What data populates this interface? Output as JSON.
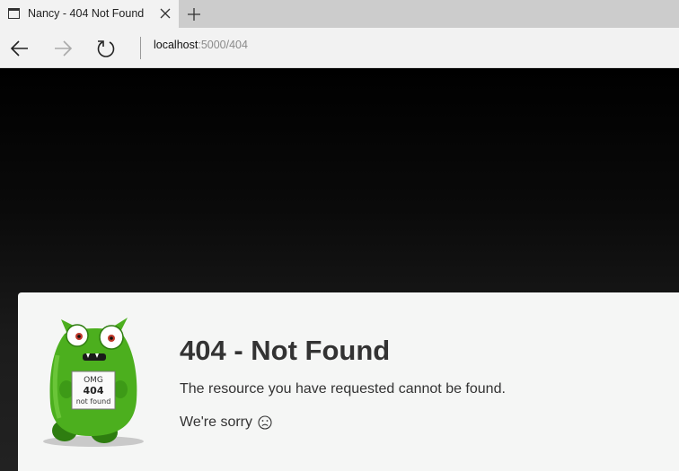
{
  "browser": {
    "tab_title": "Nancy - 404 Not Found",
    "address_host": "localhost",
    "address_rest": ":5000/404"
  },
  "mascot_sign": {
    "line1": "OMG",
    "line2": "404",
    "line3": "not found"
  },
  "error": {
    "heading": "404 - Not Found",
    "message": "The resource you have requested cannot be found.",
    "sorry": "We're sorry"
  },
  "icons": {
    "tab": "page-icon",
    "close": "close-icon",
    "new_tab": "plus-icon",
    "back": "arrow-left-icon",
    "forward": "arrow-right-icon",
    "refresh": "refresh-icon",
    "emoticon": "frown-icon"
  },
  "colors": {
    "mascot_green": "#4caf1e",
    "card_bg": "#f5f6f5",
    "text": "#333333"
  }
}
